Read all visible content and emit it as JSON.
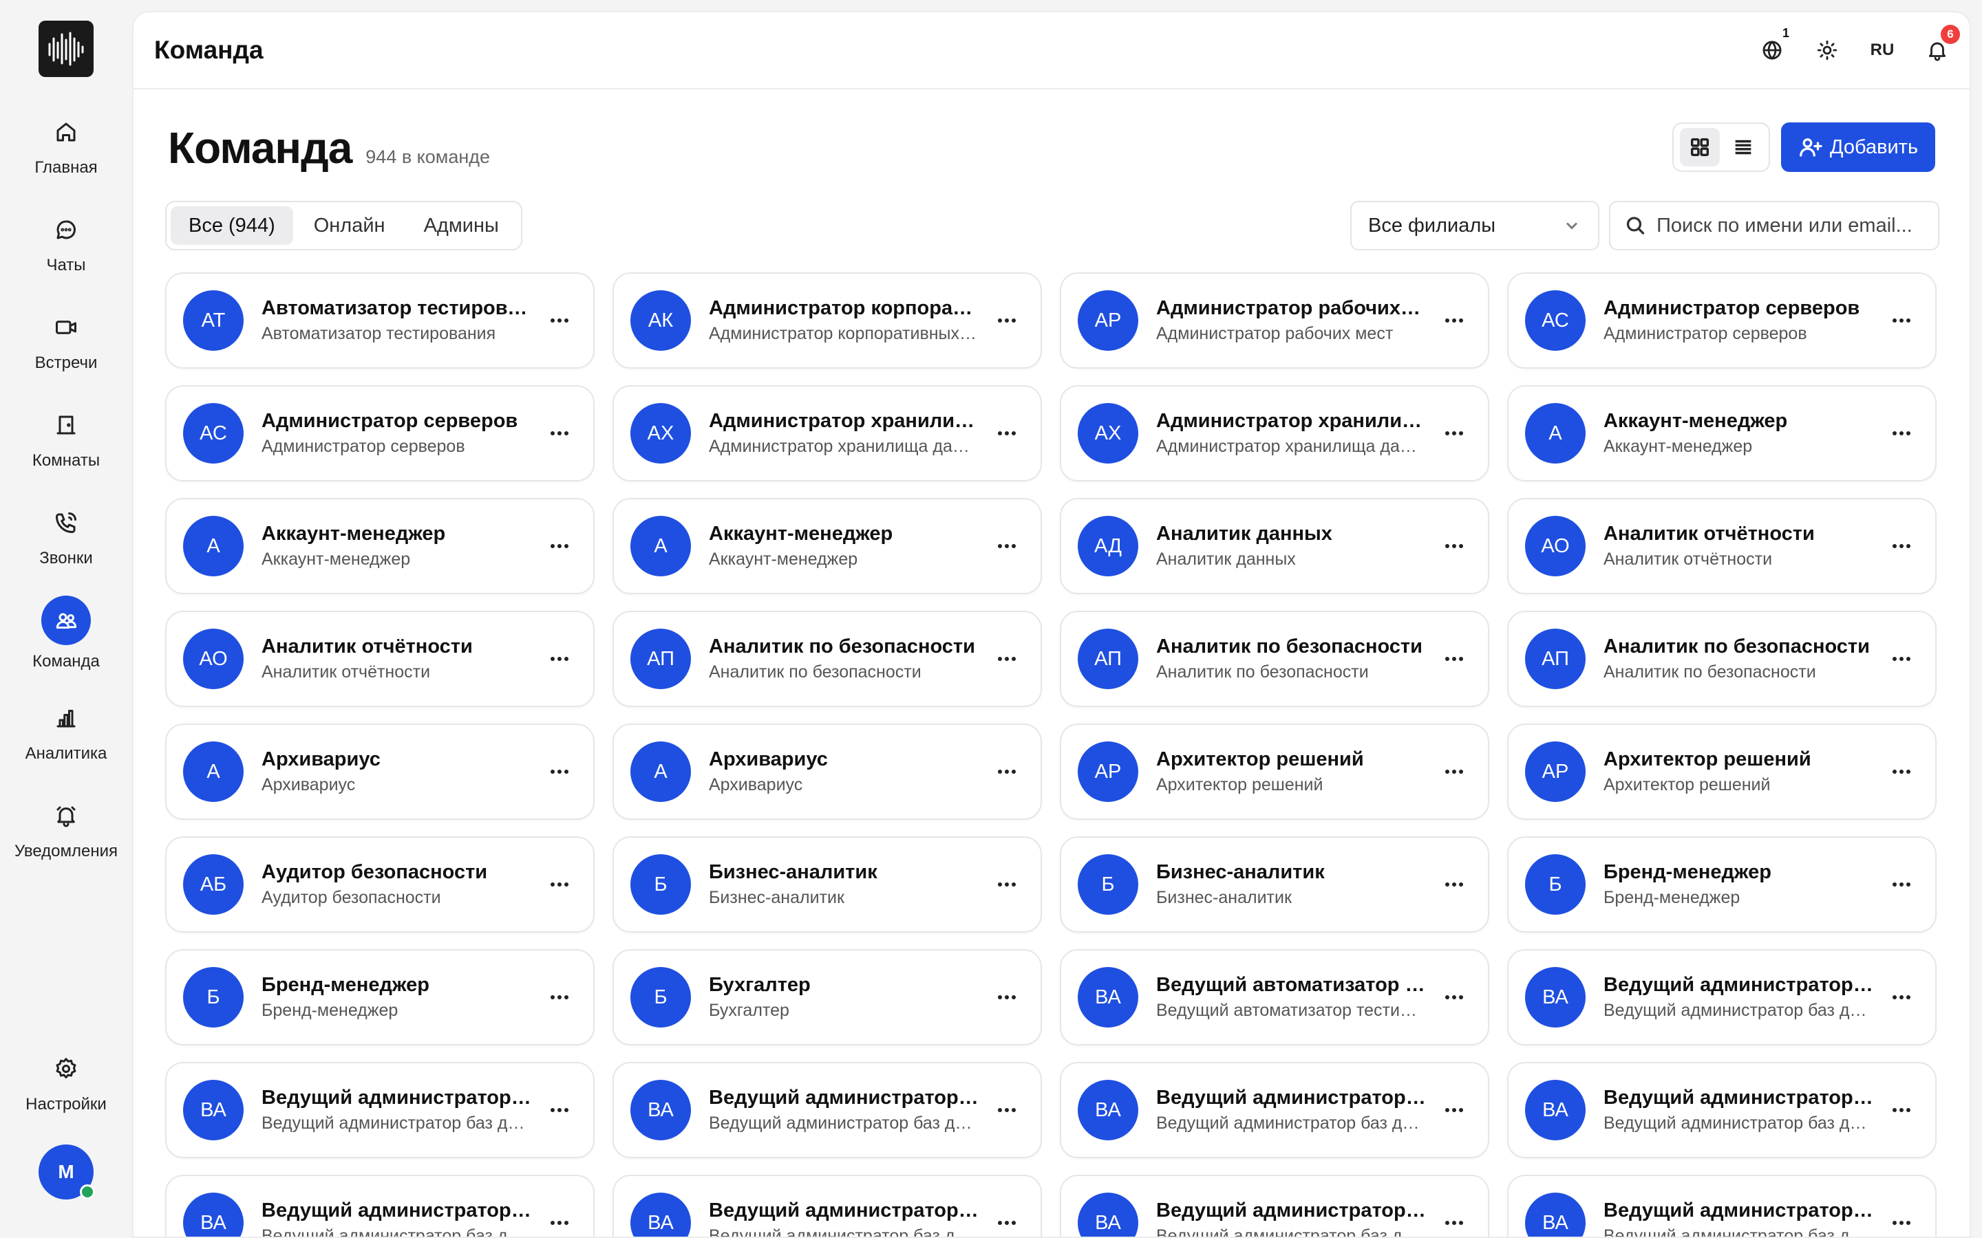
{
  "sidebar": {
    "items": [
      {
        "label": "Главная",
        "icon": "home-icon"
      },
      {
        "label": "Чаты",
        "icon": "chat-icon"
      },
      {
        "label": "Встречи",
        "icon": "video-icon"
      },
      {
        "label": "Комнаты",
        "icon": "door-icon"
      },
      {
        "label": "Звонки",
        "icon": "phone-icon"
      },
      {
        "label": "Команда",
        "icon": "team-icon",
        "active": true
      },
      {
        "label": "Аналитика",
        "icon": "analytics-icon"
      },
      {
        "label": "Уведомления",
        "icon": "bell-icon"
      }
    ],
    "settings_label": "Настройки",
    "user_initial": "M"
  },
  "topbar": {
    "title": "Команда",
    "globe_badge": "1",
    "language": "RU",
    "notifications_badge": "6"
  },
  "page": {
    "title": "Команда",
    "count": "944 в команде",
    "add_label": "Добавить",
    "tabs": [
      "Все (944)",
      "Онлайн",
      "Админы"
    ],
    "branch_select": "Все филиалы",
    "search_placeholder": "Поиск по имени или email..."
  },
  "accent_color": "#1f4fe0",
  "members": [
    {
      "initials": "АТ",
      "name": "Автоматизатор тестирования",
      "role": "Автоматизатор тестирования"
    },
    {
      "initials": "АК",
      "name": "Администратор корпоративных систем",
      "role": "Администратор корпоративных систем"
    },
    {
      "initials": "АР",
      "name": "Администратор рабочих мест",
      "role": "Администратор рабочих мест"
    },
    {
      "initials": "АС",
      "name": "Администратор серверов",
      "role": "Администратор серверов"
    },
    {
      "initials": "АС",
      "name": "Администратор серверов",
      "role": "Администратор серверов"
    },
    {
      "initials": "АХ",
      "name": "Администратор хранилища данных",
      "role": "Администратор хранилища данных"
    },
    {
      "initials": "АХ",
      "name": "Администратор хранилища данных",
      "role": "Администратор хранилища данных"
    },
    {
      "initials": "А",
      "name": "Аккаунт-менеджер",
      "role": "Аккаунт-менеджер"
    },
    {
      "initials": "А",
      "name": "Аккаунт-менеджер",
      "role": "Аккаунт-менеджер"
    },
    {
      "initials": "А",
      "name": "Аккаунт-менеджер",
      "role": "Аккаунт-менеджер"
    },
    {
      "initials": "АД",
      "name": "Аналитик данных",
      "role": "Аналитик данных"
    },
    {
      "initials": "АО",
      "name": "Аналитик отчётности",
      "role": "Аналитик отчётности"
    },
    {
      "initials": "АО",
      "name": "Аналитик отчётности",
      "role": "Аналитик отчётности"
    },
    {
      "initials": "АП",
      "name": "Аналитик по безопасности",
      "role": "Аналитик по безопасности"
    },
    {
      "initials": "АП",
      "name": "Аналитик по безопасности",
      "role": "Аналитик по безопасности"
    },
    {
      "initials": "АП",
      "name": "Аналитик по безопасности",
      "role": "Аналитик по безопасности"
    },
    {
      "initials": "А",
      "name": "Архивариус",
      "role": "Архивариус"
    },
    {
      "initials": "А",
      "name": "Архивариус",
      "role": "Архивариус"
    },
    {
      "initials": "АР",
      "name": "Архитектор решений",
      "role": "Архитектор решений"
    },
    {
      "initials": "АР",
      "name": "Архитектор решений",
      "role": "Архитектор решений"
    },
    {
      "initials": "АБ",
      "name": "Аудитор безопасности",
      "role": "Аудитор безопасности"
    },
    {
      "initials": "Б",
      "name": "Бизнес-аналитик",
      "role": "Бизнес-аналитик"
    },
    {
      "initials": "Б",
      "name": "Бизнес-аналитик",
      "role": "Бизнес-аналитик"
    },
    {
      "initials": "Б",
      "name": "Бренд-менеджер",
      "role": "Бренд-менеджер"
    },
    {
      "initials": "Б",
      "name": "Бренд-менеджер",
      "role": "Бренд-менеджер"
    },
    {
      "initials": "Б",
      "name": "Бухгалтер",
      "role": "Бухгалтер"
    },
    {
      "initials": "ВА",
      "name": "Ведущий автоматизатор тестирования",
      "role": "Ведущий автоматизатор тестирования"
    },
    {
      "initials": "ВА",
      "name": "Ведущий администратор баз данных",
      "role": "Ведущий администратор баз данных"
    },
    {
      "initials": "ВА",
      "name": "Ведущий администратор баз данных",
      "role": "Ведущий администратор баз данных"
    },
    {
      "initials": "ВА",
      "name": "Ведущий администратор баз данных",
      "role": "Ведущий администратор баз данных"
    },
    {
      "initials": "ВА",
      "name": "Ведущий администратор баз данных",
      "role": "Ведущий администратор баз данных"
    },
    {
      "initials": "ВА",
      "name": "Ведущий администратор баз данных",
      "role": "Ведущий администратор баз данных"
    },
    {
      "initials": "ВА",
      "name": "Ведущий администратор баз данных",
      "role": "Ведущий администратор баз данных"
    },
    {
      "initials": "ВА",
      "name": "Ведущий администратор баз данных",
      "role": "Ведущий администратор баз данных"
    },
    {
      "initials": "ВА",
      "name": "Ведущий администратор баз данных",
      "role": "Ведущий администратор баз данных"
    },
    {
      "initials": "ВА",
      "name": "Ведущий администратор баз данных",
      "role": "Ведущий администратор баз данных"
    }
  ]
}
